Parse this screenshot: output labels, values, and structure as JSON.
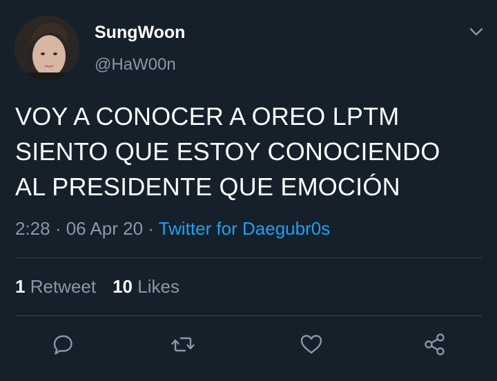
{
  "user": {
    "display_name": "SungWoon",
    "handle": "@HaW00n"
  },
  "tweet": {
    "text": "VOY A CONOCER A OREO LPTM\nSIENTO QUE ESTOY CONOCIENDO\nAL PRESIDENTE QUE EMOCIÓN",
    "time": "2:28",
    "date": "06 Apr 20",
    "separator": " · ",
    "source": "Twitter for Daegubr0s"
  },
  "stats": {
    "retweets_count": "1",
    "retweets_label": "Retweet",
    "likes_count": "10",
    "likes_label": "Likes"
  },
  "actions": {
    "reply": "reply-icon",
    "retweet": "retweet-icon",
    "like": "heart-icon",
    "share": "share-icon"
  },
  "colors": {
    "background": "#15202b",
    "text": "#ffffff",
    "muted": "#8899a6",
    "link": "#1da1f2",
    "divider": "#38444d"
  }
}
